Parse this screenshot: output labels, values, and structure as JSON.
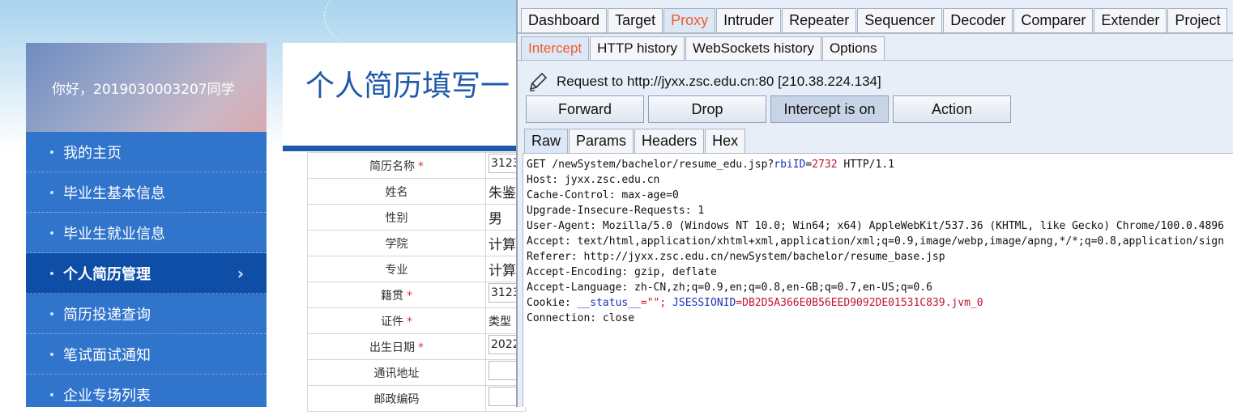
{
  "webpage": {
    "greeting": "你好，2019030003207同学",
    "menu": [
      {
        "label": "我的主页"
      },
      {
        "label": "毕业生基本信息"
      },
      {
        "label": "毕业生就业信息"
      },
      {
        "label": "个人简历管理",
        "active": true
      },
      {
        "label": "简历投递查询"
      },
      {
        "label": "笔试面试通知"
      },
      {
        "label": "企业专场列表"
      }
    ],
    "active_chevron": "›",
    "page_title": "个人简历填写一",
    "form": [
      {
        "label": "简历名称",
        "required": true,
        "value": "3123",
        "type": "input"
      },
      {
        "label": "姓名",
        "required": false,
        "value": "朱鉴",
        "type": "text"
      },
      {
        "label": "性别",
        "required": false,
        "value": "男",
        "type": "text"
      },
      {
        "label": "学院",
        "required": false,
        "value": "计算",
        "type": "text"
      },
      {
        "label": "专业",
        "required": false,
        "value": "计算",
        "type": "text"
      },
      {
        "label": "籍贯",
        "required": true,
        "value": "3123",
        "type": "input"
      },
      {
        "label": "证件",
        "required": true,
        "value": "类型",
        "type": "small"
      },
      {
        "label": "出生日期",
        "required": true,
        "value": "2022",
        "type": "input"
      },
      {
        "label": "通讯地址",
        "required": false,
        "value": "",
        "type": "input"
      },
      {
        "label": "邮政编码",
        "required": false,
        "value": "",
        "type": "input"
      }
    ],
    "required_mark": "*"
  },
  "burp": {
    "main_tabs": [
      "Dashboard",
      "Target",
      "Proxy",
      "Intruder",
      "Repeater",
      "Sequencer",
      "Decoder",
      "Comparer",
      "Extender",
      "Project"
    ],
    "main_selected": "Proxy",
    "proxy_tabs": [
      "Intercept",
      "HTTP history",
      "WebSockets history",
      "Options"
    ],
    "proxy_selected": "Intercept",
    "request_info": "Request to http://jyxx.zsc.edu.cn:80  [210.38.224.134]",
    "buttons": {
      "forward": "Forward",
      "drop": "Drop",
      "intercept": "Intercept is on",
      "action": "Action"
    },
    "view_tabs": [
      "Raw",
      "Params",
      "Headers",
      "Hex"
    ],
    "view_selected": "Raw",
    "request": {
      "line_prefix": "GET /newSystem/bachelor/resume_edu.jsp?",
      "param_name": "rbiID",
      "param_eq": "=",
      "param_value": "2732",
      "line_suffix": " HTTP/1.1",
      "headers": [
        "Host: jyxx.zsc.edu.cn",
        "Cache-Control: max-age=0",
        "Upgrade-Insecure-Requests: 1",
        "User-Agent: Mozilla/5.0 (Windows NT 10.0; Win64; x64) AppleWebKit/537.36 (KHTML, like Gecko) Chrome/100.0.4896",
        "Accept: text/html,application/xhtml+xml,application/xml;q=0.9,image/webp,image/apng,*/*;q=0.8,application/sign",
        "Referer: http://jyxx.zsc.edu.cn/newSystem/bachelor/resume_base.jsp",
        "Accept-Encoding: gzip, deflate",
        "Accept-Language: zh-CN,zh;q=0.9,en;q=0.8,en-GB;q=0.7,en-US;q=0.6"
      ],
      "cookie_prefix": "Cookie: ",
      "cookie1_name": "__status__",
      "cookie1_value": "=\"\"; ",
      "cookie2_name": "JSESSIONID",
      "cookie2_value": "=DB2D5A366E0B56EED9092DE01531C839.jvm_0",
      "connection": "Connection: close"
    }
  },
  "colors": {
    "proxy_selected_text": "#f05a28",
    "sidebar_bg": "#3174cc",
    "title_blue": "#1f5aa8",
    "param_key": "#1a33b8",
    "param_value": "#c0152f"
  },
  "icons": {
    "pencil": "pencil-icon",
    "chevron": "chevron-right-icon"
  }
}
